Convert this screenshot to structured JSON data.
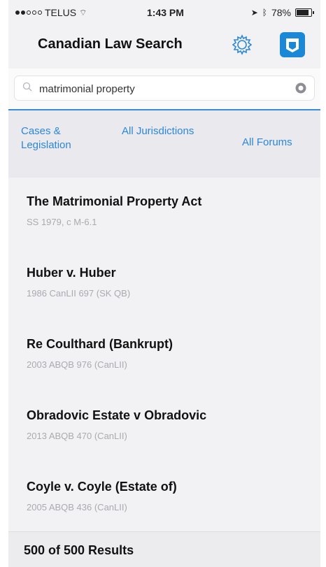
{
  "status": {
    "carrier": "TELUS",
    "time": "1:43 PM",
    "battery": "78%"
  },
  "nav": {
    "title": "Canadian Law Search",
    "settings_icon": "gear-icon",
    "canlii_icon": "canlii-logo-icon"
  },
  "search": {
    "value": "matrimonial property"
  },
  "filters": [
    {
      "label": "Cases & Legislation"
    },
    {
      "label": "All Jurisdictions"
    },
    {
      "label": "All Forums"
    }
  ],
  "results": [
    {
      "title": "The Matrimonial Property Act",
      "citation": "SS 1979, c M-6.1"
    },
    {
      "title": "Huber v. Huber",
      "citation": "1986 CanLII 697 (SK QB)"
    },
    {
      "title": "Re Coulthard (Bankrupt)",
      "citation": "2003 ABQB 976 (CanLII)"
    },
    {
      "title": "Obradovic Estate v Obradovic",
      "citation": "2013 ABQB 470 (CanLII)"
    },
    {
      "title": "Coyle v. Coyle (Estate of)",
      "citation": "2005 ABQB 436 (CanLII)"
    }
  ],
  "footer": {
    "count": "500 of 500 Results"
  },
  "colors": {
    "accent": "#2d87d6",
    "logo": "#1a88d6"
  }
}
